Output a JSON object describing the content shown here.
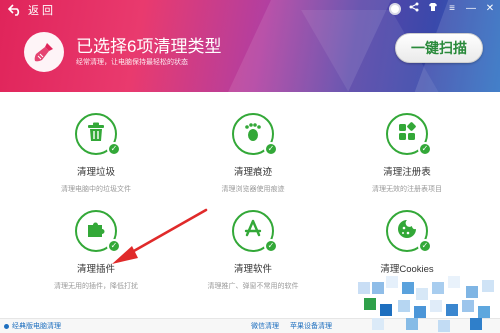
{
  "topbar": {
    "back_label": "返 回",
    "icons": [
      "avatar-icon",
      "share-icon",
      "shirt-icon",
      "menu-icon",
      "minimize-icon",
      "close-icon"
    ]
  },
  "header": {
    "title": "已选择6项清理类型",
    "subtitle": "经常清理，让电脑保持最轻松的状态",
    "scan_button": "一键扫描"
  },
  "items": [
    {
      "label": "清理垃圾",
      "desc": "清理电脑中的垃圾文件",
      "icon": "trash-icon",
      "checked": true
    },
    {
      "label": "清理痕迹",
      "desc": "清理浏览器使用痕迹",
      "icon": "footprint-icon",
      "checked": true
    },
    {
      "label": "清理注册表",
      "desc": "清理无效的注册表项目",
      "icon": "registry-icon",
      "checked": true
    },
    {
      "label": "清理插件",
      "desc": "清理无用的插件，降低打扰",
      "icon": "puzzle-icon",
      "checked": true
    },
    {
      "label": "清理软件",
      "desc": "清理推广、弹窗不常用的软件",
      "icon": "appstore-icon",
      "checked": true
    },
    {
      "label": "清理Cookies",
      "desc": "",
      "icon": "cookie-icon",
      "checked": true
    }
  ],
  "footer": {
    "left_link": "经典版电脑清理",
    "link_wechat": "微信清理",
    "link_apple": "苹果设备清理"
  },
  "colors": {
    "accent_green": "#33a838",
    "header_pink": "#e0245a",
    "header_blue": "#2a6fc2",
    "arrow_red": "#e02a2a",
    "link_blue": "#1e6fbf"
  }
}
